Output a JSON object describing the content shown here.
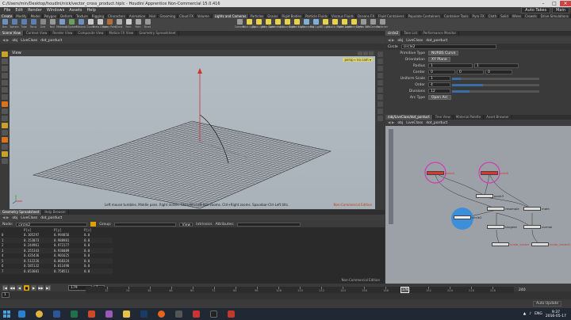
{
  "window": {
    "title": "C:/Users/min/Desktop/houdini/nick/vector_cross_product.hiplc - Houdini Apprentice Non-Commercial 15.0.416"
  },
  "menubar": {
    "items": [
      "File",
      "Edit",
      "Render",
      "Windows",
      "Assets",
      "Help"
    ],
    "right": [
      "Auto Takes",
      "Main"
    ]
  },
  "shelf": {
    "tabs_left": [
      "Create",
      "Modify",
      "Model",
      "Polygon",
      "Deform",
      "Texture",
      "Rigging",
      "Characters",
      "Animation",
      "Hair",
      "Grooming",
      "Cloud FX",
      "Volume"
    ],
    "tabs_right": [
      "Lights and Cameras",
      "Particles",
      "Grains",
      "Rigid Bodies",
      "Particle Fluids",
      "Viscous Fluids",
      "Oceans FX",
      "Fluid Containers",
      "Populate Containers",
      "Container Tools",
      "Pyro FX",
      "Cloth",
      "Solid",
      "Wires",
      "Crowds",
      "Drive Simulations"
    ],
    "tools_left": [
      {
        "label": "Box",
        "color": "#6c8fbf"
      },
      {
        "label": "Sphere",
        "color": "#5a7fb0"
      },
      {
        "label": "Tube",
        "color": "#5a7fb0"
      },
      {
        "label": "Torus",
        "color": "#5a7fb0"
      },
      {
        "label": "Grid",
        "color": "#888"
      },
      {
        "label": "Null",
        "color": "#999"
      },
      {
        "label": "Metaball",
        "color": "#7a9ac7"
      },
      {
        "label": "L-System",
        "color": "#6aa05a"
      },
      {
        "label": "Platonic",
        "color": "#6c8fbf"
      },
      {
        "label": "Curve",
        "color": "#c9c9c9"
      },
      {
        "label": "Draw Curve",
        "color": "#c9c9c9"
      },
      {
        "label": "Spray Paint",
        "color": "#b46e3a"
      },
      {
        "label": "Circle",
        "color": "#aaa"
      },
      {
        "label": "Font",
        "color": "#ccc"
      },
      {
        "label": "Path",
        "color": "#aaa"
      },
      {
        "label": "Rivet",
        "color": "#999"
      }
    ],
    "tools_right": [
      {
        "label": "Camera",
        "color": "#999"
      },
      {
        "label": "Point Light",
        "color": "#e8d24a"
      },
      {
        "label": "Spot Light",
        "color": "#e8d24a"
      },
      {
        "label": "Area Light",
        "color": "#e8d24a"
      },
      {
        "label": "Geometry Li...",
        "color": "#e8d24a"
      },
      {
        "label": "Volume Light",
        "color": "#e8d24a"
      },
      {
        "label": "Distant Light",
        "color": "#e8d24a"
      },
      {
        "label": "Environment",
        "color": "#7fb0d6"
      },
      {
        "label": "Sky Light",
        "color": "#7fb0d6"
      },
      {
        "label": "GI Light",
        "color": "#e8d24a"
      },
      {
        "label": "Caustic Light",
        "color": "#e8d24a"
      },
      {
        "label": "Portal Light",
        "color": "#e8d24a"
      },
      {
        "label": "Ambient Light",
        "color": "#e8d24a"
      },
      {
        "label": "Stereo Cam",
        "color": "#999"
      },
      {
        "label": "VR Camera",
        "color": "#999"
      },
      {
        "label": "Switcher",
        "color": "#999"
      }
    ]
  },
  "scene_pane": {
    "tabs": [
      "Scene View",
      "Context View",
      "Render View",
      "Composite View",
      "Motion FX View",
      "Geometry Spreadsheet"
    ],
    "path": [
      "obj",
      "LiveClass",
      "dot_porduct"
    ],
    "title": "View",
    "persp": "persp ▾",
    "cam": "no cam ▾",
    "hint": "Left mouse tumbles. Middle pans. Right dollies. Ctrl+Alt+Left box-zooms. Ctrl+Right zooms. Spacebar-Ctrl-Left tilts.",
    "watermark": "Non-Commercial Edition"
  },
  "spreadsheet": {
    "tabs": [
      "Geometry Spreadsheet",
      "Help Browser"
    ],
    "path": [
      "obj",
      "LiveClass",
      "dot_porduct"
    ],
    "node_label": "Node:",
    "node": "circle2",
    "group_label": "Group:",
    "view_label": "View",
    "intrinsics": "Intrinsics",
    "attributes_label": "Attributes:",
    "columns": [
      "",
      "P[x]",
      "P[y]",
      "P[z]"
    ],
    "rows": [
      [
        "0",
        "0.105297",
        "0.994856",
        "0.0"
      ],
      [
        "1",
        "0.153073",
        "0.988981",
        "0.0"
      ],
      [
        "2",
        "0.244961",
        "0.972177",
        "0.0"
      ],
      [
        "3",
        "0.355343",
        "0.936089",
        "0.0"
      ],
      [
        "4",
        "0.435436",
        "0.901625",
        "0.0"
      ],
      [
        "5",
        "0.512226",
        "0.868324",
        "0.0"
      ],
      [
        "6",
        "0.585132",
        "0.811498",
        "0.0"
      ],
      [
        "7",
        "0.653601",
        "0.758511",
        "0.0"
      ]
    ],
    "watermark": "Non-Commercial Edition"
  },
  "timeline": {
    "frame": "179",
    "start": "1",
    "end_field": "1",
    "end": "240",
    "current": "179",
    "ticks": [
      "12",
      "24",
      "36",
      "48",
      "60",
      "72",
      "84",
      "96",
      "108",
      "120",
      "132",
      "144",
      "156",
      "168",
      "180",
      "192",
      "204",
      "216",
      "228"
    ],
    "current_fraction": 0.745,
    "auto_update": "Auto Update"
  },
  "parm_pane": {
    "tabs": [
      "circle2",
      "Take List",
      "Performance Monitor"
    ],
    "path": [
      "obj",
      "LiveClass",
      "dot_porduct"
    ],
    "node_type": "Circle",
    "node_name": "circle2",
    "parms": [
      {
        "label": "Primitive Type",
        "dd": "NURBS Curve"
      },
      {
        "label": "Orientation",
        "dd": "XY Plane"
      },
      {
        "label": "Radius",
        "vals": [
          "1",
          "1"
        ]
      },
      {
        "label": "Center",
        "vals": [
          "0",
          "0",
          "0"
        ]
      },
      {
        "label": "Uniform Scale",
        "vals": [
          "1"
        ],
        "slider": 0.1
      },
      {
        "label": "Order",
        "vals": [
          "4"
        ],
        "slider": 0.35
      },
      {
        "label": "Divisions",
        "vals": [
          "12"
        ],
        "slider": 0.2
      },
      {
        "label": "Arc Type",
        "dd": "Open Arc"
      }
    ]
  },
  "network_pane": {
    "tabs": [
      "/obj/LiveClass/dot_porduct",
      "Tree View",
      "Material Palette",
      "Asset Browser"
    ],
    "path": [
      "obj",
      "LiveClass",
      "dot_porduct"
    ],
    "nodes": [
      {
        "label": "point4",
        "name": "point4-node"
      },
      {
        "label": "point8",
        "name": "point8-node"
      },
      {
        "label": "point3",
        "name": "point3-node"
      },
      {
        "label": "circle2",
        "name": "circle2-node"
      },
      {
        "label": "resample",
        "name": "resample-node"
      },
      {
        "label": "tangent",
        "name": "tangent-node"
      },
      {
        "label": "math",
        "name": "math-node"
      },
      {
        "label": "normal",
        "name": "normal-node"
      },
      {
        "label": "hcolo_vector",
        "name": "hcolo-vector-node"
      },
      {
        "label": "hcolo_vector2",
        "name": "hcolo-vector2-node"
      }
    ]
  },
  "taskbar": {
    "time": "9:37",
    "date": "2016-05-17",
    "lang": "ENG"
  }
}
